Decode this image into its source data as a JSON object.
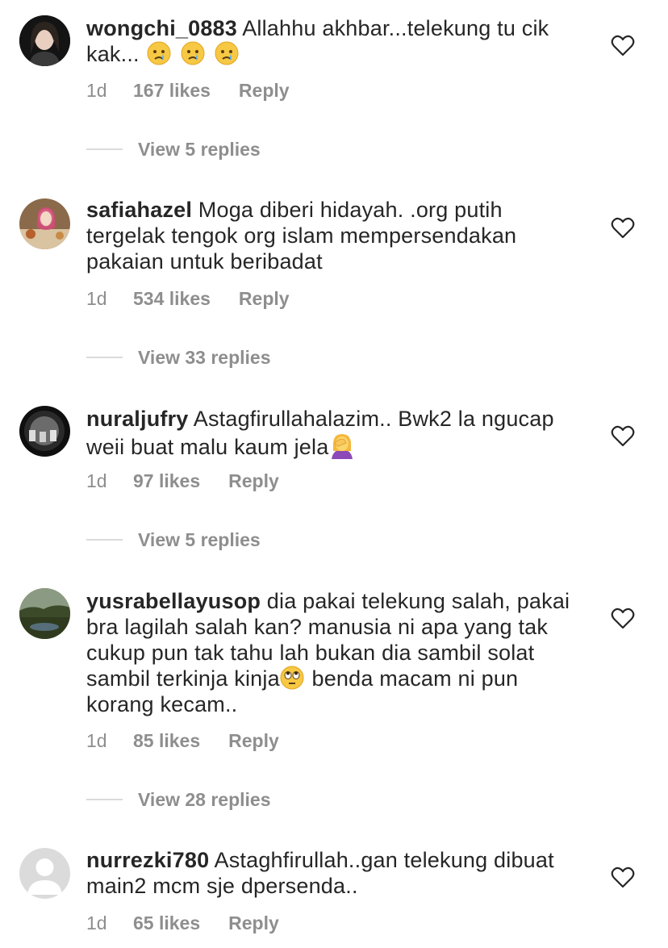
{
  "comments": [
    {
      "username": "wongchi_0883",
      "text": "Allahhu akhbar...telekung tu cik kak...",
      "emojis": [
        "crying-face-emoji",
        "crying-face-emoji",
        "crying-face-emoji"
      ],
      "time": "1d",
      "likes": "167 likes",
      "reply": "Reply",
      "view_replies": "View 5 replies"
    },
    {
      "username": "safiahazel",
      "text": "Moga diberi hidayah. .org putih tergelak tengok org islam mempersendakan pakaian untuk beribadat",
      "time": "1d",
      "likes": "534 likes",
      "reply": "Reply",
      "view_replies": "View 33 replies"
    },
    {
      "username": "nuraljufry",
      "text": "Astagfirullahalazim.. Bwk2 la ngucap weii buat malu kaum jela",
      "emojis": [
        "facepalm-emoji"
      ],
      "time": "1d",
      "likes": "97 likes",
      "reply": "Reply",
      "view_replies": "View 5 replies"
    },
    {
      "username": "yusrabellayusop",
      "text_a": "dia pakai telekung salah, pakai bra lagilah salah kan? manusia ni apa yang tak cukup pun tak tahu lah bukan dia sambil solat sambil terkinja kinja",
      "text_b": " benda macam ni pun korang kecam..",
      "emojis": [
        "eye-roll-emoji"
      ],
      "time": "1d",
      "likes": "85 likes",
      "reply": "Reply",
      "view_replies": "View 28 replies"
    },
    {
      "username": "nurrezki780",
      "text": "Astaghfirullah..gan telekung dibuat main2 mcm sje dpersenda..",
      "time": "1d",
      "likes": "65 likes",
      "reply": "Reply"
    }
  ],
  "colors": {
    "text": "#262626",
    "muted": "#8e8e8e",
    "divider": "#dbdbdb",
    "background": "#ffffff"
  }
}
